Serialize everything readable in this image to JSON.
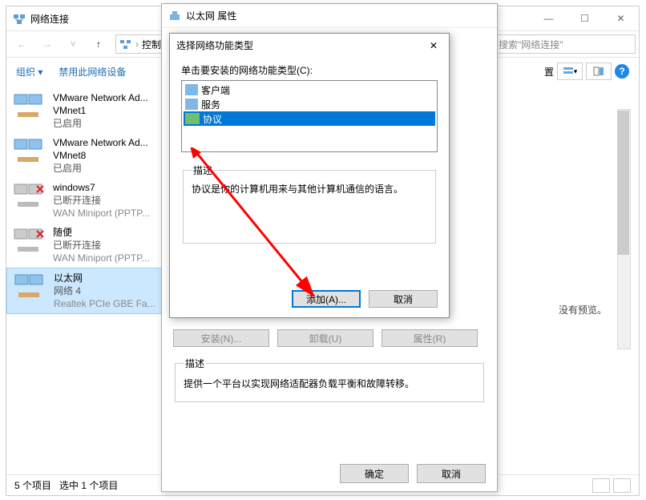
{
  "window": {
    "title": "网络连接",
    "min": "—",
    "max": "☐",
    "close": "✕"
  },
  "nav": {
    "breadcrumb": "控制面板",
    "search_placeholder": "搜索\"网络连接\""
  },
  "toolbar": {
    "organize": "组织 ▾",
    "disable": "禁用此网络设备",
    "settings_label": "置"
  },
  "adapters": [
    {
      "name": "VMware Network Ad...",
      "sub": "VMnet1",
      "status": "已启用",
      "detail": ""
    },
    {
      "name": "VMware Network Ad...",
      "sub": "VMnet8",
      "status": "已启用",
      "detail": ""
    },
    {
      "name": "windows7",
      "sub": "",
      "status": "已断开连接",
      "detail": "WAN Miniport (PPTP..."
    },
    {
      "name": "随便",
      "sub": "",
      "status": "已断开连接",
      "detail": "WAN Miniport (PPTP..."
    },
    {
      "name": "以太网",
      "sub": "",
      "status": "网络 4",
      "detail": "Realtek PCIe GBE Fa..."
    }
  ],
  "preview": {
    "no_preview": "没有预览。"
  },
  "statusbar": {
    "items": "5 个项目",
    "selected": "选中 1 个项目"
  },
  "dlg1": {
    "title": "以太网 属性",
    "install": "安装(N)...",
    "uninstall": "卸载(U)",
    "properties": "属性(R)",
    "desc_legend": "描述",
    "desc_text": "提供一个平台以实现网络适配器负载平衡和故障转移。",
    "ok": "确定",
    "cancel": "取消"
  },
  "dlg2": {
    "title": "选择网络功能类型",
    "close": "✕",
    "click_label": "单击要安装的网络功能类型(C):",
    "items": {
      "client": "客户端",
      "service": "服务",
      "protocol": "协议"
    },
    "desc_legend": "描述",
    "desc_text": "协议是你的计算机用来与其他计算机通信的语言。",
    "add": "添加(A)...",
    "cancel": "取消"
  }
}
